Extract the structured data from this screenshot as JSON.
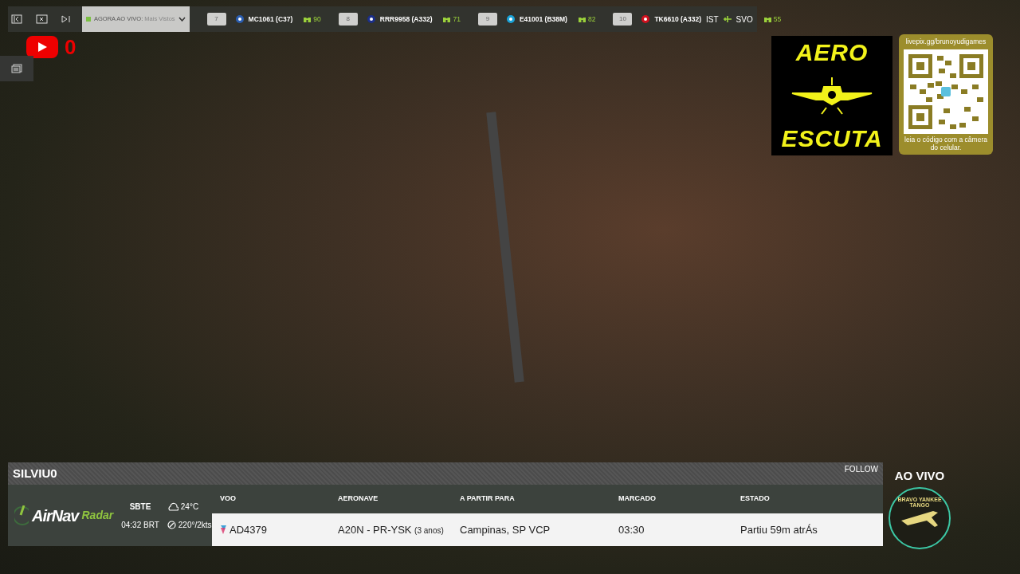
{
  "toolbar": {
    "buttons": [
      {
        "kind": "collapse"
      },
      {
        "kind": "fullscreen"
      },
      {
        "kind": "next"
      }
    ],
    "live_dropdown": {
      "label": "AGORA AO VIVO:",
      "value": "Mais Vistos"
    },
    "flights": [
      {
        "slot": "7",
        "callsign": "MC1061 (C37)",
        "watchers": "90",
        "color": "#2a5db0"
      },
      {
        "slot": "8",
        "callsign": "RRR9958 (A332)",
        "watchers": "71",
        "color": "#1b2f8a"
      },
      {
        "slot": "9",
        "callsign": "E41001 (B38M)",
        "watchers": "82",
        "color": "#1aa3d9"
      },
      {
        "slot": "10",
        "callsign": "TK6610 (A332)",
        "route": {
          "origin": "IST",
          "destination": "SVO"
        },
        "watchers": "55",
        "color": "#d0101e"
      }
    ]
  },
  "youtube": {
    "count": "0"
  },
  "aero_logo": {
    "top": "AERO",
    "bottom": "ESCUTA"
  },
  "qr_card": {
    "url": "livepix.gg/brunoyudigames",
    "caption": "leia o código com a câmera do celular."
  },
  "flight_panel": {
    "title": "SILVIU0",
    "follow": "FOLLOW",
    "brand": {
      "name": "AirNav",
      "suffix": "Radar"
    },
    "airport": "SBTE",
    "time": "04:32 BRT",
    "temperature": "24°C",
    "wind": "220°/2kts",
    "columns": [
      "VOO",
      "AERONAVE",
      "A PARTIR PARA",
      "MARCADO",
      "ESTADO"
    ],
    "row": {
      "flight": "AD4379",
      "aircraft": "A20N - PR-YSK",
      "age": "(3 anos)",
      "route": "Campinas, SP VCP",
      "scheduled": "03:30",
      "status": "Partiu 59m atrÁs"
    }
  },
  "live_badge": {
    "label": "AO VIVO",
    "emblem_text": "BRAVO YANKEE TANGO"
  }
}
